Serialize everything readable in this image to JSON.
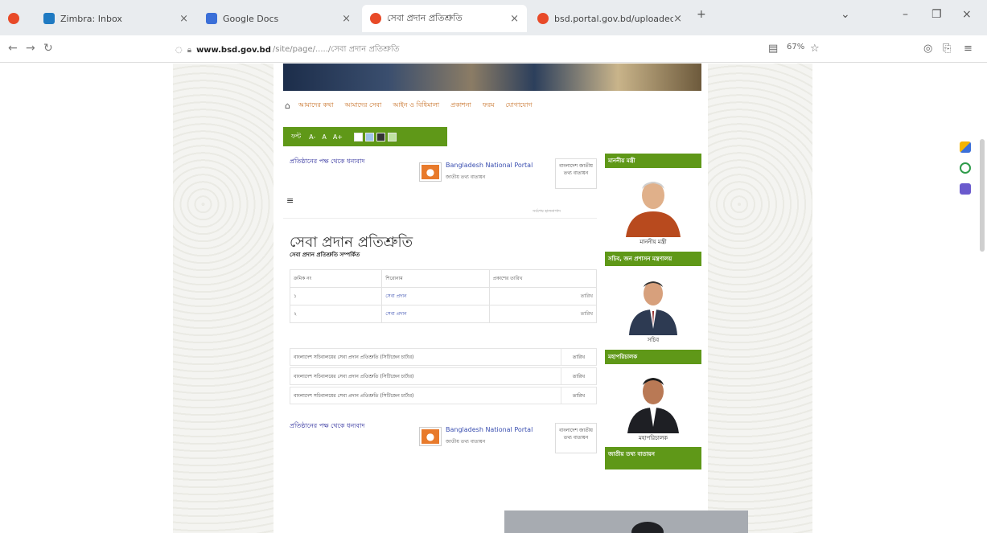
{
  "browser": {
    "tabs": [
      {
        "title": "Zimbra: Inbox",
        "color": "#1f7ac2",
        "active": false
      },
      {
        "title": "Google Docs",
        "color": "#3b6fd8",
        "active": false
      },
      {
        "title": "সেবা প্রদান প্রতিশ্রুতি",
        "color": "#e84a28",
        "active": true
      },
      {
        "title": "bsd.portal.gov.bd/uploaded-c",
        "color": "#e84a28",
        "active": false
      }
    ],
    "new_tab": "+",
    "url_host": "www.bsd.gov.bd",
    "url_path": "/site/page/...../সেবা প্রদান প্রতিশ্রুতি",
    "zoom": "67%"
  },
  "site": {
    "nav": [
      "প্রচ্ছদ",
      "আমাদের কথা",
      "আমাদের সেবা",
      "আইন ও বিধিমালা",
      "প্রকাশনা",
      "ফরম",
      "যোগাযোগ"
    ],
    "share_label": "প্রতিষ্ঠানের পক্ষ থেকে ধন্যবাদ",
    "portal_title": "Bangladesh National Portal",
    "portal_sub": "জাতীয় তথ্য বাতায়ন",
    "bn_box": "বাংলাদেশ জাতীয় তথ্য বাতায়ন",
    "updated": "সর্বশেষ হালনাগাদ",
    "page_title": "সেবা প্রদান প্রতিশ্রুতি",
    "page_sub": "সেবা প্রদান প্রতিশ্রুতি সম্পর্কিত",
    "table": {
      "headers": [
        "ক্রমিক নং",
        "শিরোনাম",
        "প্রকাশের তারিখ"
      ],
      "rows": [
        [
          "১",
          "সেবা প্রদান",
          "তারিখ"
        ],
        [
          "২",
          "সেবা প্রদান",
          "তারিখ"
        ]
      ]
    },
    "files": [
      {
        "title": "বাংলাদেশ সচিবালয়ের সেবা প্রদান প্রতিশ্রুতি (সিটিজেন চার্টার)",
        "date": "তারিখ"
      },
      {
        "title": "বাংলাদেশ সচিবালয়ের সেবা প্রদান প্রতিশ্রুতি (সিটিজেন চার্টার)",
        "date": "তারিখ"
      },
      {
        "title": "বাংলাদেশ সচিবালয়ের সেবা প্রদান প্রতিশ্রুতি (সিটিজেন চার্টার)",
        "date": "তারিখ"
      }
    ],
    "sidebar": [
      {
        "heading": "মাননীয় মন্ত্রী",
        "name": "মাননীয় মন্ত্রী"
      },
      {
        "heading": "সচিব, জন প্রশাসন মন্ত্রণালয়",
        "name": "সচিব"
      },
      {
        "heading": "মহাপরিচালক",
        "name": "মহাপরিচালক"
      },
      {
        "heading": "জাতীয় তথ্য বাতায়ন",
        "name": ""
      }
    ]
  }
}
